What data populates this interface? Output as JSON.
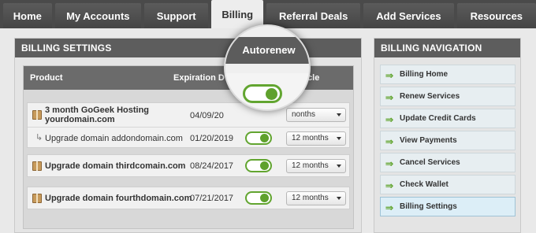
{
  "tabs": [
    "Home",
    "My Accounts",
    "Support",
    "Billing",
    "Referral Deals",
    "Add Services",
    "Resources"
  ],
  "active_tab": "Billing",
  "billing_settings": {
    "title": "BILLING SETTINGS",
    "columns": {
      "product": "Product",
      "expiration": "Expiration D",
      "cycle": "Cycle"
    },
    "magnifier_label": "Autorenew",
    "rows": [
      {
        "product": "3 month GoGeek Hosting",
        "product_line2": "yourdomain.com",
        "date": "04/09/20",
        "cycle": "nonths",
        "autorenew": true
      },
      {
        "product": "Upgrade domain addondomain.com",
        "date": "01/20/2019",
        "cycle": "12 months",
        "autorenew": true,
        "sub": true
      },
      {
        "product": "Upgrade domain thirdcomain.com",
        "date": "08/24/2017",
        "cycle": "12 months",
        "autorenew": true
      },
      {
        "product": "Upgrade domain fourthdomain.com",
        "date": "07/21/2017",
        "cycle": "12 months",
        "autorenew": true
      }
    ]
  },
  "billing_navigation": {
    "title": "BILLING NAVIGATION",
    "items": [
      "Billing Home",
      "Renew Services",
      "Update Credit Cards",
      "View Payments",
      "Cancel Services",
      "Check Wallet",
      "Billing Settings"
    ],
    "active": "Billing Settings"
  },
  "icons": {
    "arrow": "green-right-arrow-icon",
    "package": "package-icon",
    "sub": "sub-arrow-icon"
  },
  "colors": {
    "accent_green": "#5fa12d",
    "header_gray": "#5d5d5d"
  }
}
